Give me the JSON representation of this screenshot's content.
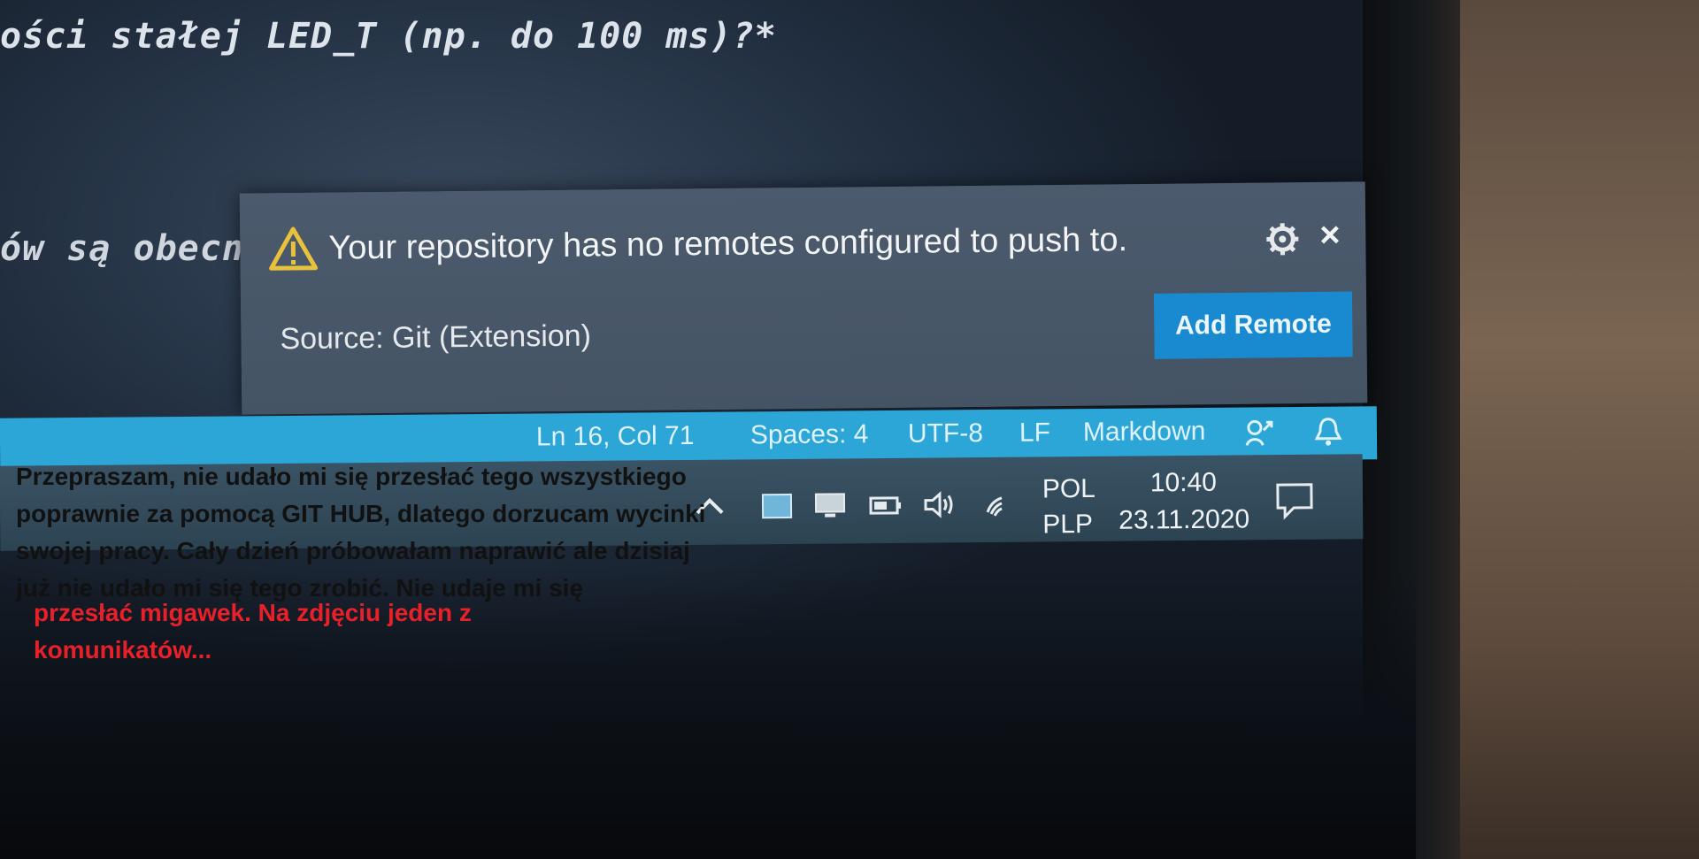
{
  "editor": {
    "line1": "ości stałej LED_T (np. do 100 ms)?*",
    "line2": "ów są obecne"
  },
  "notification": {
    "message": "Your repository has no remotes configured to push to.",
    "source": "Source: Git (Extension)",
    "action_label": "Add Remote",
    "icons": [
      "warning-icon",
      "gear-icon",
      "close-icon"
    ],
    "close_glyph": "×"
  },
  "statusbar": {
    "position": "Ln 16, Col 71",
    "spaces": "Spaces: 4",
    "encoding": "UTF-8",
    "eol": "LF",
    "language": "Markdown",
    "color": "#2ba6d6"
  },
  "taskbar": {
    "lang_line1": "POL",
    "lang_line2": "PLP",
    "time": "10:40",
    "date": "23.11.2020"
  },
  "overlay": {
    "black_lines": [
      "Przepraszam, nie udało mi się przesłać tego wszystkiego",
      "poprawnie za pomocą GIT HUB, dlatego dorzucam wycinki",
      "swojej pracy. Cały dzień próbowałam naprawić ale dzisiaj",
      "już nie udało mi się tego zrobić. Nie udaje mi się"
    ],
    "red_lines": [
      "przesłać migawek. Na zdjęciu jeden z",
      "komunikatów..."
    ],
    "red_color": "#e8202a"
  }
}
